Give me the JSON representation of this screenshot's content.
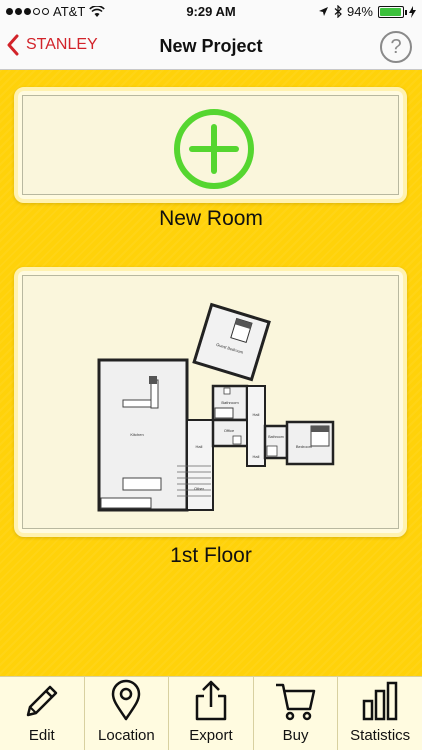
{
  "status_bar": {
    "carrier": "AT&T",
    "time": "9:29 AM",
    "battery": "94%",
    "battery_level": 0.94
  },
  "nav": {
    "back_label": "STANLEY",
    "title": "New Project",
    "help_label": "?"
  },
  "cards": {
    "new_room_label": "New Room",
    "floor_label": "1st Floor",
    "floor_plan_rooms": {
      "kitchen": "Kitchen",
      "hall1": "Hall",
      "bathroom": "Bathroom",
      "office": "Office",
      "hall2": "Hall",
      "bathroom2": "Bathroom",
      "bedroom": "Bedroom",
      "guest_bedroom": "Guest Bedroom",
      "hall3": "Hall",
      "other": "Other"
    }
  },
  "tabs": [
    {
      "label": "Edit",
      "icon": "pencil-icon"
    },
    {
      "label": "Location",
      "icon": "location-pin-icon"
    },
    {
      "label": "Export",
      "icon": "share-icon"
    },
    {
      "label": "Buy",
      "icon": "cart-icon"
    },
    {
      "label": "Statistics",
      "icon": "bar-chart-icon"
    }
  ]
}
